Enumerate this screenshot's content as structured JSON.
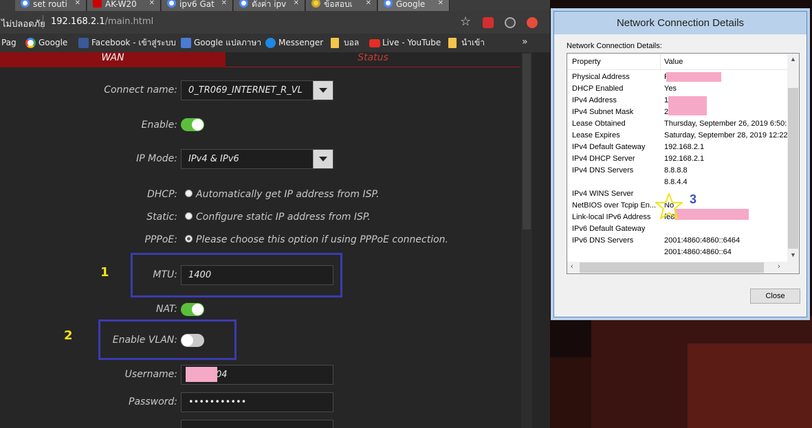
{
  "browser": {
    "tabs": [
      {
        "label": "set routi"
      },
      {
        "label": "AK-W20"
      },
      {
        "label": "ipv6 Gat"
      },
      {
        "label": "ตั้งค่า ipv"
      },
      {
        "label": "ข้อสอบเ"
      },
      {
        "label": "Google"
      }
    ],
    "address": {
      "secure_label": "ไม่ปลอดภัย",
      "host": "192.168.2.1",
      "path": "/main.html"
    },
    "bookmarks": [
      {
        "label": "Pag"
      },
      {
        "label": "Google"
      },
      {
        "label": "Facebook - เข้าสู่ระบบ"
      },
      {
        "label": "Google แปลภาษา"
      },
      {
        "label": "Messenger"
      },
      {
        "label": "บอล"
      },
      {
        "label": "Live - YouTube"
      },
      {
        "label": "นำเข้า"
      }
    ],
    "more_label": "»"
  },
  "router": {
    "tabs": {
      "wan": "WAN",
      "status": "Status"
    },
    "connect_name": {
      "label": "Connect name:",
      "value": "0_TR069_INTERNET_R_VL"
    },
    "enable": {
      "label": "Enable:",
      "on": true
    },
    "ip_mode": {
      "label": "IP Mode:",
      "value": "IPv4 & IPv6"
    },
    "dhcp": {
      "label": "DHCP:",
      "text": "Automatically get IP address from ISP."
    },
    "static": {
      "label": "Static:",
      "text": "Configure static IP address from ISP."
    },
    "pppoe": {
      "label": "PPPoE:",
      "text": "Please choose this option if using PPPoE connection."
    },
    "mtu": {
      "label": "MTU:",
      "value": "1400"
    },
    "nat": {
      "label": "NAT:",
      "on": true
    },
    "enable_vlan": {
      "label": "Enable VLAN:",
      "on": false
    },
    "username": {
      "label": "Username:",
      "value_suffix": "04"
    },
    "password": {
      "label": "Password:",
      "value": "•••••••••••"
    },
    "annotations": {
      "one": "1",
      "two": "2"
    }
  },
  "dialog": {
    "title": "Network Connection Details",
    "subtitle": "Network Connection Details:",
    "col_property": "Property",
    "col_value": "Value",
    "rows": [
      {
        "property": "Physical Address",
        "value": "F                  F"
      },
      {
        "property": "DHCP Enabled",
        "value": "Yes"
      },
      {
        "property": "IPv4 Address",
        "value": "1                    0"
      },
      {
        "property": "IPv4 Subnet Mask",
        "value": "2                    0"
      },
      {
        "property": "Lease Obtained",
        "value": "Thursday, September 26, 2019 6:50:2"
      },
      {
        "property": "Lease Expires",
        "value": "Saturday, September 28, 2019 12:22:"
      },
      {
        "property": "IPv4 Default Gateway",
        "value": "192.168.2.1"
      },
      {
        "property": "IPv4 DHCP Server",
        "value": "192.168.2.1"
      },
      {
        "property": "IPv4 DNS Servers",
        "value": "8.8.8.8"
      },
      {
        "property": "",
        "value": "8.8.4.4"
      },
      {
        "property": "IPv4 WINS Server",
        "value": ""
      },
      {
        "property": "NetBIOS over Tcpip En...",
        "value": "No"
      },
      {
        "property": "Link-local IPv6 Address",
        "value": "fe8                              2%4"
      },
      {
        "property": "IPv6 Default Gateway",
        "value": ""
      },
      {
        "property": "IPv6 DNS Servers",
        "value": "2001:4860:4860::6464"
      },
      {
        "property": "",
        "value": "2001:4860:4860::64"
      }
    ],
    "close_label": "Close",
    "annotation": "3"
  }
}
